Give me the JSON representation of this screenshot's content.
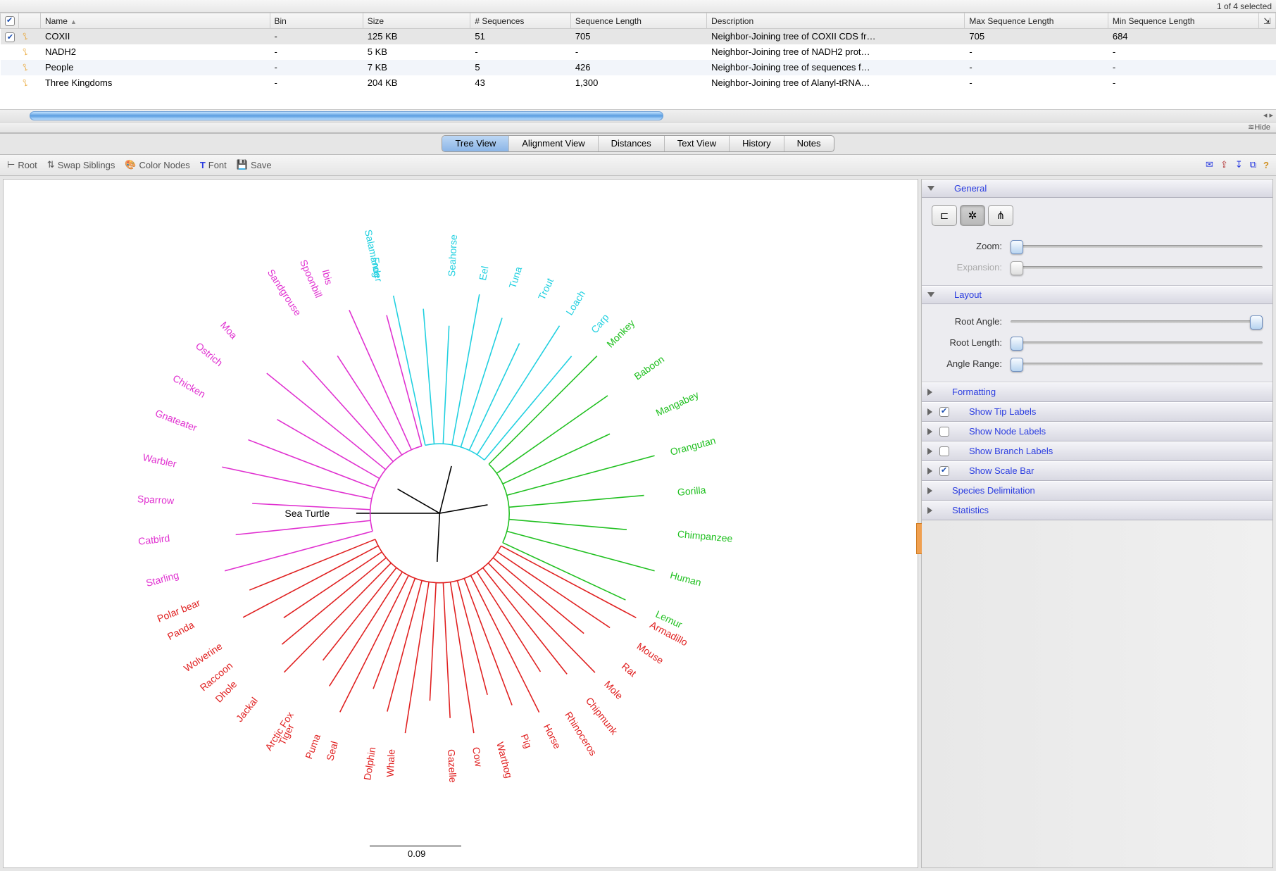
{
  "status": {
    "selection_text": "1 of 4 selected"
  },
  "table": {
    "columns": [
      "Name",
      "Bin",
      "Size",
      "# Sequences",
      "Sequence Length",
      "Description",
      "Max Sequence Length",
      "Min Sequence Length"
    ],
    "sort_column": "Name",
    "rows": [
      {
        "checked": true,
        "selected": true,
        "name": "COXII",
        "bin": "-",
        "size": "125 KB",
        "nseq": "51",
        "seqlen": "705",
        "desc": "Neighbor-Joining tree of COXII CDS fr…",
        "max": "705",
        "min": "684"
      },
      {
        "checked": false,
        "selected": false,
        "name": "NADH2",
        "bin": "-",
        "size": "5 KB",
        "nseq": "-",
        "seqlen": "-",
        "desc": "Neighbor-Joining tree of NADH2 prot…",
        "max": "-",
        "min": "-"
      },
      {
        "checked": false,
        "selected": false,
        "alt": true,
        "name": "People",
        "bin": "-",
        "size": "7 KB",
        "nseq": "5",
        "seqlen": "426",
        "desc": "Neighbor-Joining tree of sequences f…",
        "max": "-",
        "min": "-"
      },
      {
        "checked": false,
        "selected": false,
        "name": "Three Kingdoms",
        "bin": "-",
        "size": "204 KB",
        "nseq": "43",
        "seqlen": "1,300",
        "desc": "Neighbor-Joining tree of Alanyl-tRNA…",
        "max": "-",
        "min": "-"
      }
    ]
  },
  "hide_label": "Hide",
  "tabs": {
    "items": [
      "Tree View",
      "Alignment View",
      "Distances",
      "Text View",
      "History",
      "Notes"
    ],
    "active": 0
  },
  "toolbar": {
    "root": "Root",
    "swap": "Swap Siblings",
    "color": "Color Nodes",
    "font": "Font",
    "save": "Save"
  },
  "tree": {
    "root_label": "Sea Turtle",
    "scale_value": "0.09",
    "groups": {
      "magenta": [
        "Starling",
        "Catbird",
        "Sparrow",
        "Warbler",
        "Gnateater",
        "Chicken",
        "Ostrich",
        "Moa",
        "Sandgrouse",
        "Spoonbill",
        "Ibis"
      ],
      "cyan": [
        "Salamander",
        "Frog",
        "Seahorse",
        "Eel",
        "Tuna",
        "Trout",
        "Loach",
        "Carp"
      ],
      "green": [
        "Monkey",
        "Baboon",
        "Mangabey",
        "Orangutan",
        "Gorilla",
        "Chimpanzee",
        "Human",
        "Lemur"
      ],
      "red": [
        "Armadillo",
        "Mouse",
        "Rat",
        "Mole",
        "Chipmunk",
        "Rhinoceros",
        "Horse",
        "Pig",
        "Warthog",
        "Cow",
        "Gazelle",
        "Whale",
        "Dolphin",
        "Seal",
        "Puma",
        "Tiger",
        "Arctic Fox",
        "Jackal",
        "Dhole",
        "Raccoon",
        "Wolverine",
        "Panda",
        "Polar bear"
      ]
    }
  },
  "sidebar": {
    "general": {
      "title": "General",
      "zoom": "Zoom:",
      "expansion": "Expansion:"
    },
    "layout": {
      "title": "Layout",
      "root_angle": "Root Angle:",
      "root_length": "Root Length:",
      "angle_range": "Angle Range:"
    },
    "collapsed": [
      {
        "title": "Formatting",
        "check": null
      },
      {
        "title": "Show Tip Labels",
        "check": true
      },
      {
        "title": "Show Node Labels",
        "check": false
      },
      {
        "title": "Show Branch Labels",
        "check": false
      },
      {
        "title": "Show Scale Bar",
        "check": true
      },
      {
        "title": "Species Delimitation",
        "check": null
      },
      {
        "title": "Statistics",
        "check": null
      }
    ]
  }
}
